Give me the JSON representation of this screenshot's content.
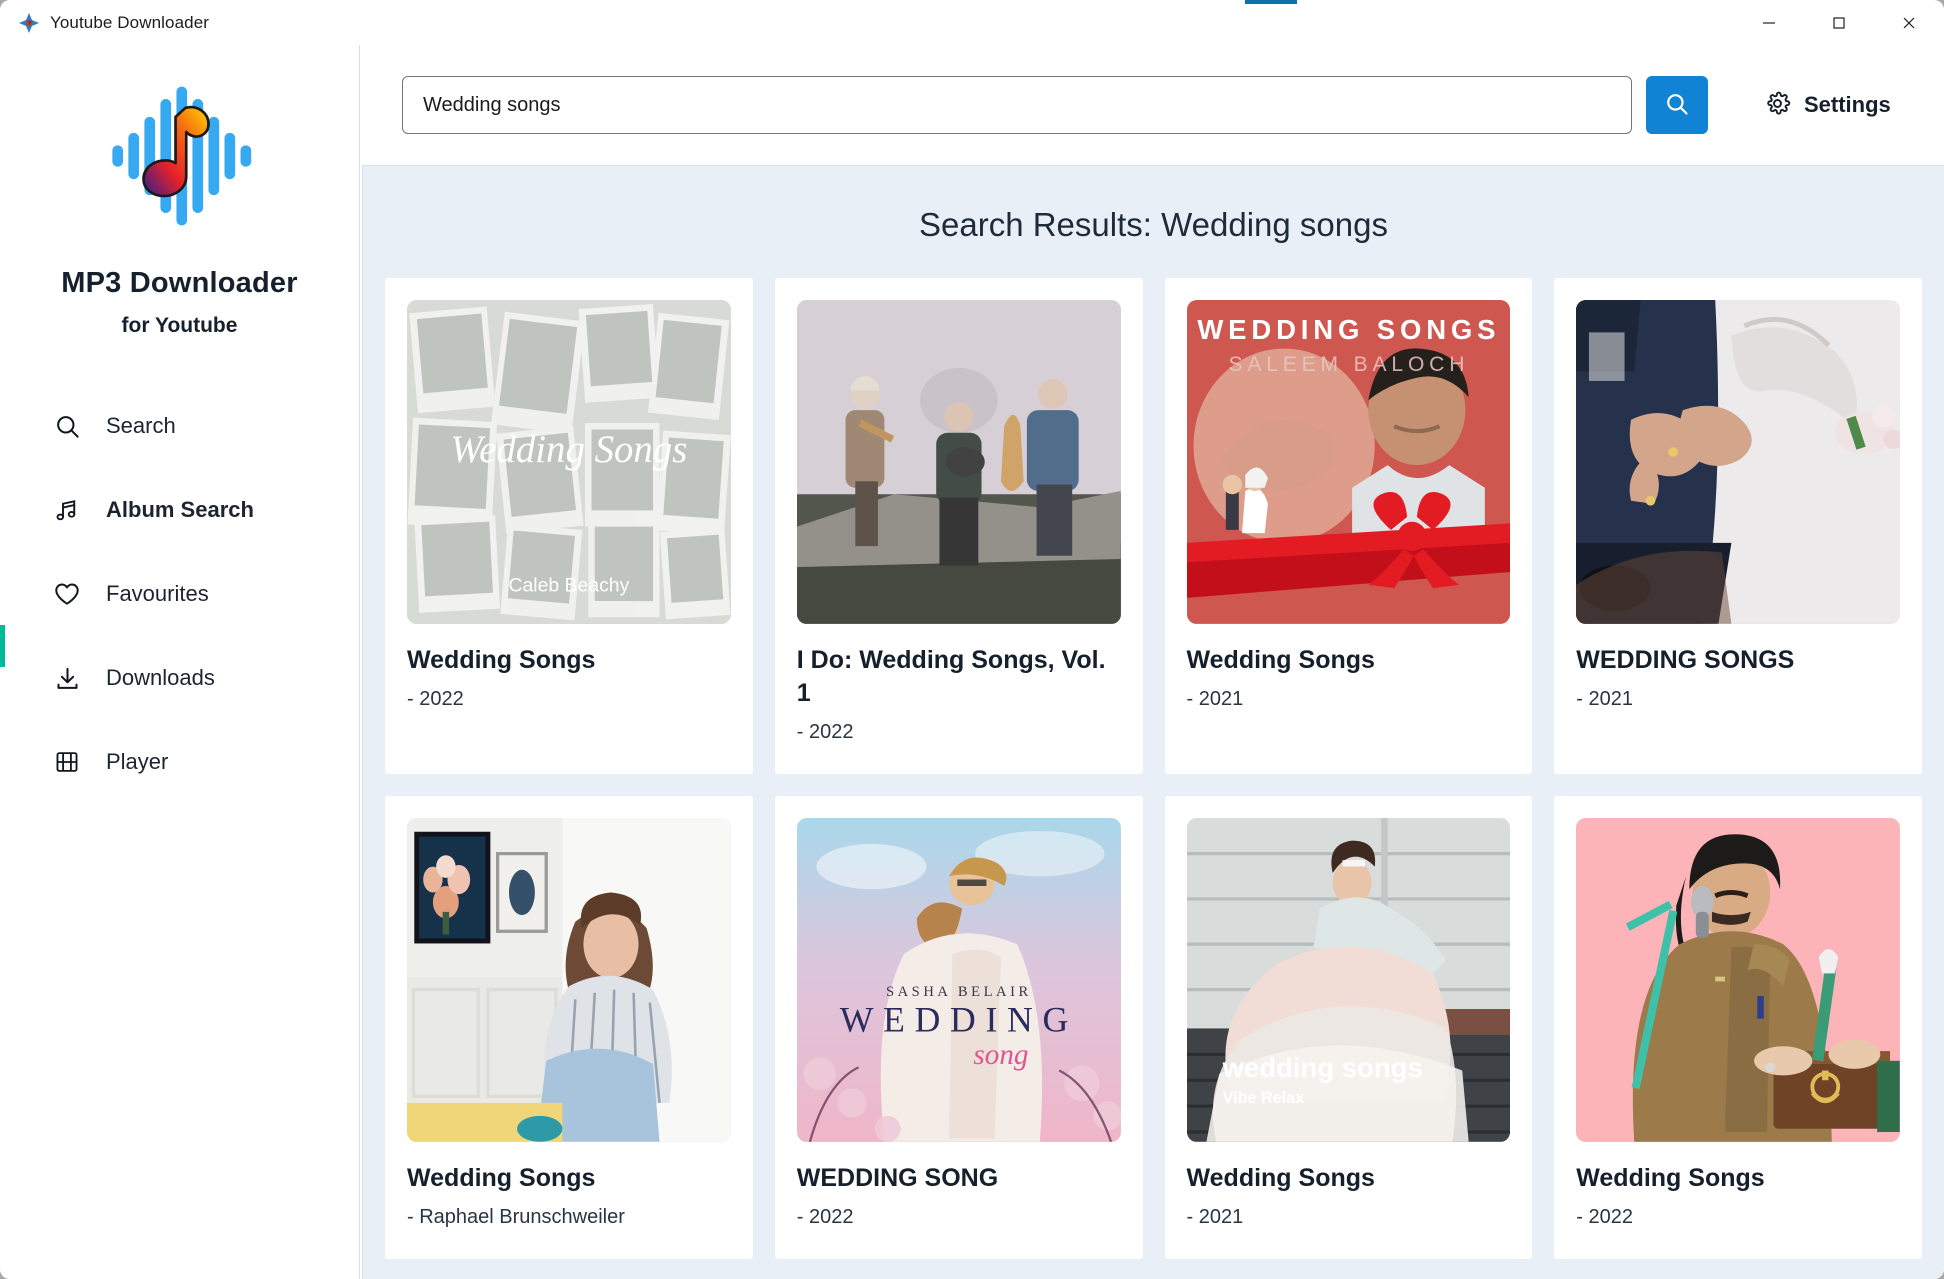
{
  "window": {
    "title": "Youtube Downloader",
    "icon": "app-logo-icon",
    "controls": {
      "minimize": "—",
      "maximize": "□",
      "close": "✕"
    }
  },
  "sidebar": {
    "logo_icon": "music-waveform-logo",
    "brand": "MP3 Downloader",
    "brand_sub": "for Youtube",
    "items": [
      {
        "label": "Search",
        "icon": "search-icon",
        "active": false
      },
      {
        "label": "Album Search",
        "icon": "music-note-icon",
        "active": true
      },
      {
        "label": "Favourites",
        "icon": "heart-icon",
        "active": false
      },
      {
        "label": "Downloads",
        "icon": "download-icon",
        "active": false
      },
      {
        "label": "Player",
        "icon": "film-icon",
        "active": false
      }
    ]
  },
  "topbar": {
    "search_value": "Wedding songs",
    "search_placeholder": "Search",
    "search_button_icon": "search-icon",
    "settings_label": "Settings",
    "settings_icon": "gear-icon",
    "accent_color": "#1183d4"
  },
  "results": {
    "heading": "Search Results: Wedding songs",
    "background_color": "#e9eff7",
    "cards": [
      {
        "title": "Wedding Songs",
        "subtitle": "- 2022",
        "art": "polaroid-collage",
        "art_caption": "Wedding Songs",
        "art_caption2": "Caleb Beachy"
      },
      {
        "title": "I Do: Wedding Songs, Vol. 1",
        "subtitle": "- 2022",
        "art": "band-on-log",
        "art_caption": "",
        "art_caption2": ""
      },
      {
        "title": "Wedding Songs",
        "subtitle": "- 2021",
        "art": "red-ribbon-singer",
        "art_caption": "WEDDING SONGS",
        "art_caption2": "SALEEM BALOCH"
      },
      {
        "title": "WEDDING SONGS",
        "subtitle": "- 2021",
        "art": "holding-hands",
        "art_caption": "",
        "art_caption2": ""
      },
      {
        "title": "Wedding Songs",
        "subtitle": "- Raphael Brunschweiler",
        "art": "woman-in-room",
        "art_caption": "",
        "art_caption2": ""
      },
      {
        "title": "WEDDING SONG",
        "subtitle": "- 2022",
        "art": "couple-blanket",
        "art_caption": "WEDDING",
        "art_caption2": "SASHA BELAIR"
      },
      {
        "title": "Wedding Songs",
        "subtitle": "- 2021",
        "art": "bride-twirling",
        "art_caption": "wedding songs",
        "art_caption2": "Vibe Relax"
      },
      {
        "title": "Wedding Songs",
        "subtitle": "- 2022",
        "art": "harmonium-singer",
        "art_caption": "",
        "art_caption2": ""
      }
    ]
  }
}
